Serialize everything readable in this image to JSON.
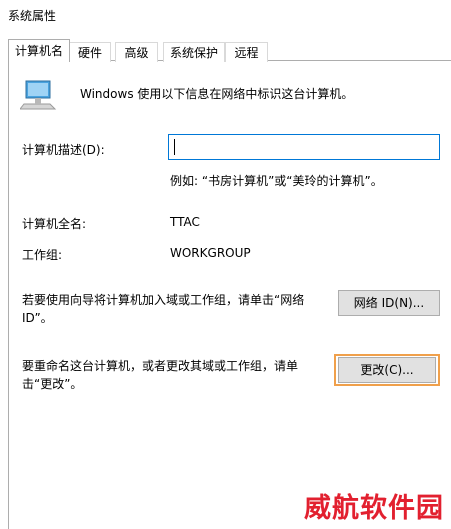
{
  "window": {
    "title": "系统属性"
  },
  "tabs": [
    {
      "label": "计算机名",
      "active": true
    },
    {
      "label": "硬件",
      "active": false
    },
    {
      "label": "高级",
      "active": false
    },
    {
      "label": "系统保护",
      "active": false
    },
    {
      "label": "远程",
      "active": false
    }
  ],
  "intro": {
    "icon": "computer-icon",
    "text": "Windows 使用以下信息在网络中标识这台计算机。"
  },
  "description": {
    "label": "计算机描述(D):",
    "value": "",
    "example": "例如: “书房计算机”或“美玲的计算机”。"
  },
  "full_name": {
    "label": "计算机全名:",
    "value": "TTAC"
  },
  "workgroup": {
    "label": "工作组:",
    "value": "WORKGROUP"
  },
  "network_id": {
    "text": "若要使用向导将计算机加入域或工作组，请单击“网络 ID”。",
    "button": "网络 ID(N)..."
  },
  "change": {
    "text": "要重命名这台计算机，或者更改其域或工作组，请单击“更改”。",
    "button": "更改(C)..."
  },
  "watermark": "威航软件园",
  "colors": {
    "focus_border": "#0078d7",
    "highlight_border": "#f0a04b",
    "watermark": "#e2202f"
  }
}
